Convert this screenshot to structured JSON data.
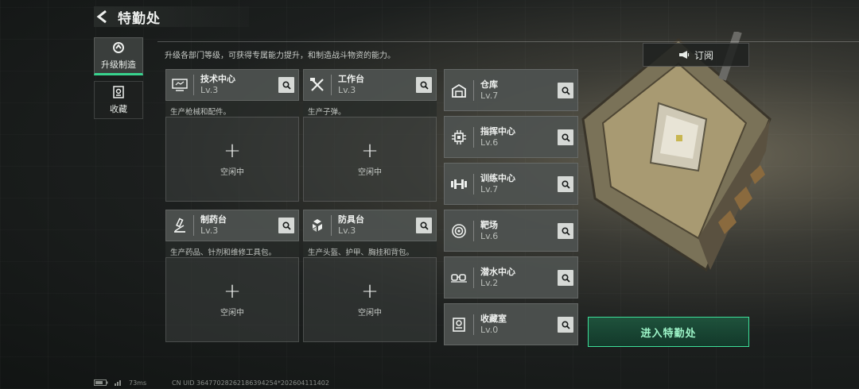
{
  "header": {
    "title": "特勤处"
  },
  "tabs": [
    {
      "label": "升级制造",
      "active": true
    },
    {
      "label": "收藏",
      "active": false
    }
  ],
  "description": "升级各部门等级，可获得专属能力提升，和制造战斗物资的能力。",
  "facilities": [
    {
      "name": "技术中心",
      "level": "Lv.3",
      "desc": "生产枪械和配件。",
      "slot_plus": "+",
      "slot_status": "空闲中",
      "icon": "computer-icon"
    },
    {
      "name": "工作台",
      "level": "Lv.3",
      "desc": "生产子弹。",
      "slot_plus": "+",
      "slot_status": "空闲中",
      "icon": "tools-icon"
    },
    {
      "name": "制药台",
      "level": "Lv.3",
      "desc": "生产药品、针剂和维修工具包。",
      "slot_plus": "+",
      "slot_status": "空闲中",
      "icon": "microscope-icon"
    },
    {
      "name": "防具台",
      "level": "Lv.3",
      "desc": "生产头盔、护甲、胸挂和背包。",
      "slot_plus": "+",
      "slot_status": "空闲中",
      "icon": "armor-icon"
    }
  ],
  "side_facilities": [
    {
      "name": "仓库",
      "level": "Lv.7",
      "icon": "warehouse-icon"
    },
    {
      "name": "指挥中心",
      "level": "Lv.6",
      "icon": "chip-icon"
    },
    {
      "name": "训练中心",
      "level": "Lv.7",
      "icon": "dumbbell-icon"
    },
    {
      "name": "靶场",
      "level": "Lv.6",
      "icon": "target-icon"
    },
    {
      "name": "潜水中心",
      "level": "Lv.2",
      "icon": "goggles-icon"
    },
    {
      "name": "收藏室",
      "level": "Lv.0",
      "icon": "vault-icon"
    }
  ],
  "subscribe_label": "订阅",
  "enter_label": "进入特勤处",
  "footer": {
    "ping": "73ms",
    "uid": "CN UID 36477028262186394254*202604111402"
  },
  "colors": {
    "accent": "#38d38e",
    "enter_border": "#3ee09a"
  }
}
